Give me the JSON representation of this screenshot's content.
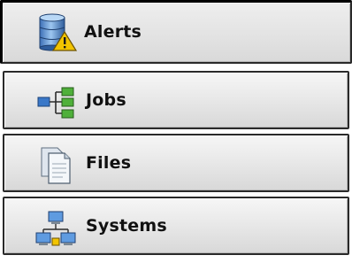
{
  "nav": {
    "items": [
      {
        "label": "Alerts",
        "icon": "server-alert-icon",
        "active": true
      },
      {
        "label": "Jobs",
        "icon": "job-flow-icon",
        "active": false
      },
      {
        "label": "Files",
        "icon": "document-files-icon",
        "active": false
      },
      {
        "label": "Systems",
        "icon": "networked-systems-icon",
        "active": false
      }
    ]
  },
  "colors": {
    "border": "#2a2a2a",
    "button_light": "#f6f6f6",
    "button_dark": "#d8d8d8",
    "text": "#111111",
    "alert_yellow": "#f2c400",
    "icon_blue": "#3a78c8",
    "icon_green": "#4fb03a"
  }
}
